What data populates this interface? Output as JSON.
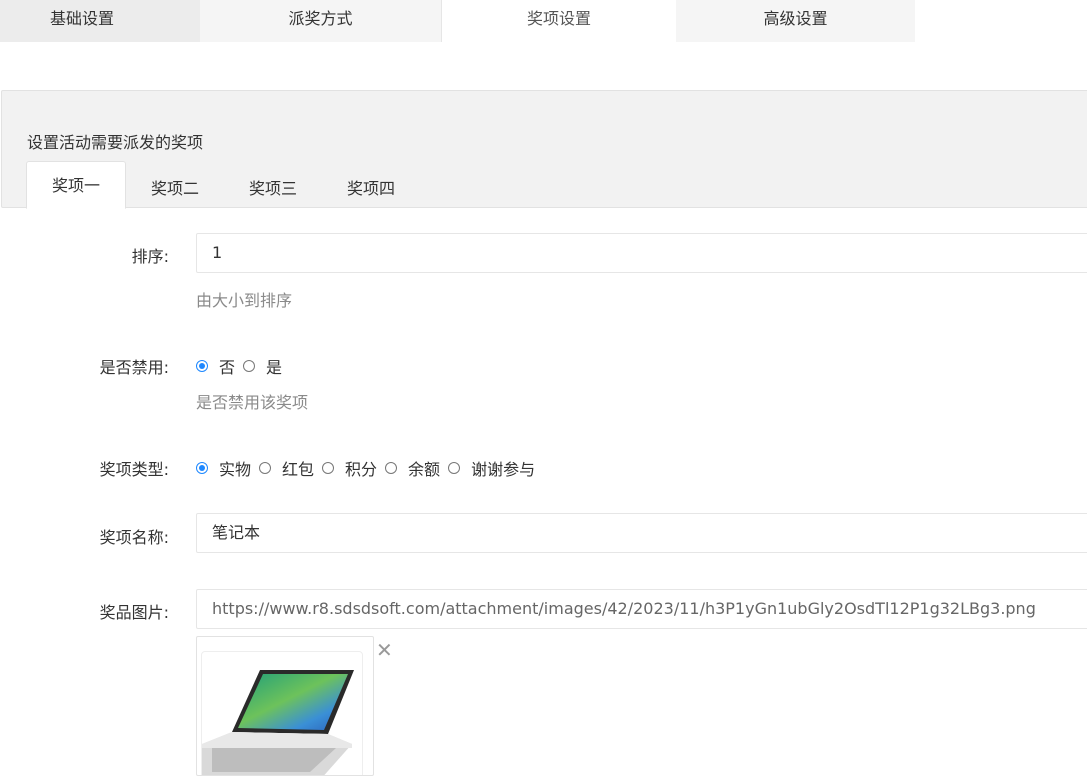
{
  "top_tabs": [
    {
      "label": "基础设置"
    },
    {
      "label": "派奖方式"
    },
    {
      "label": "奖项设置"
    },
    {
      "label": "高级设置"
    }
  ],
  "active_top_tab": "奖项设置",
  "panel": {
    "title": "设置活动需要派发的奖项",
    "tabs": [
      {
        "label": "奖项一"
      },
      {
        "label": "奖项二"
      },
      {
        "label": "奖项三"
      },
      {
        "label": "奖项四"
      }
    ],
    "active_tab": "奖项一"
  },
  "form": {
    "sort": {
      "label": "排序:",
      "value": "1",
      "help": "由大小到排序"
    },
    "disabled": {
      "label": "是否禁用:",
      "options": [
        {
          "label": "否",
          "checked": true
        },
        {
          "label": "是",
          "checked": false
        }
      ],
      "help": "是否禁用该奖项"
    },
    "type": {
      "label": "奖项类型:",
      "options": [
        {
          "label": "实物",
          "checked": true
        },
        {
          "label": "红包",
          "checked": false
        },
        {
          "label": "积分",
          "checked": false
        },
        {
          "label": "余额",
          "checked": false
        },
        {
          "label": "谢谢参与",
          "checked": false
        }
      ]
    },
    "name": {
      "label": "奖项名称:",
      "value": "笔记本"
    },
    "image": {
      "label": "奖品图片:",
      "value": "https://www.r8.sdsdsoft.com/attachment/images/42/2023/11/h3P1yGn1ubGly2OsdTl12P1g32LBg3.png",
      "remove_symbol": "✕"
    }
  },
  "colors": {
    "accent": "#1e88ff",
    "border": "#e2e2e2",
    "panel_bg": "#f2f2f2",
    "help_text": "#8a8a8a"
  }
}
